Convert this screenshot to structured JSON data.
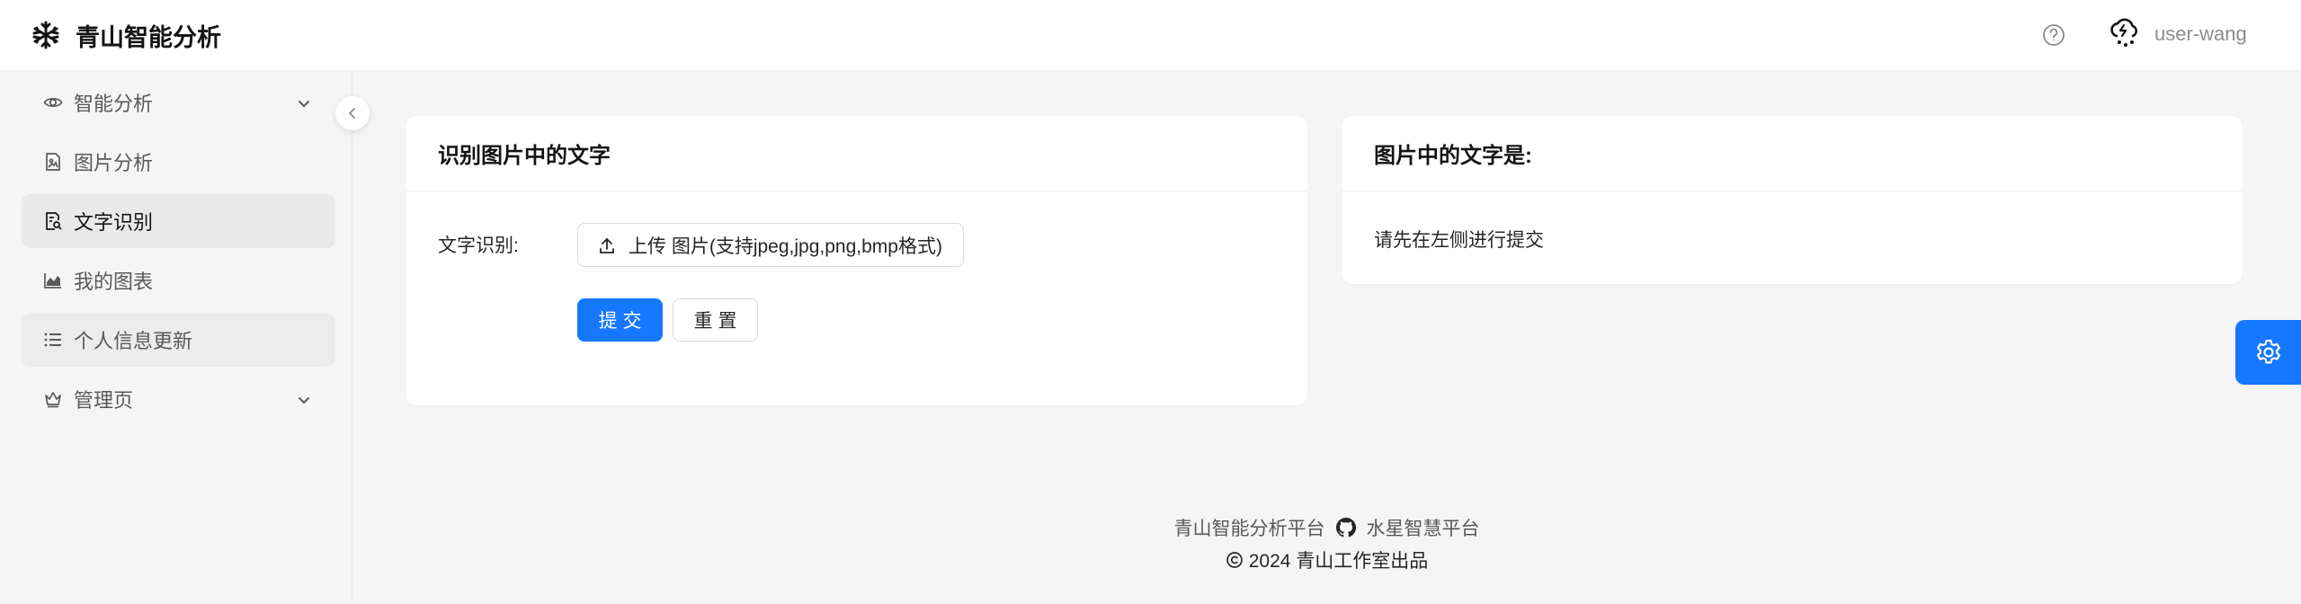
{
  "header": {
    "app_title": "青山智能分析",
    "user_name": "user-wang",
    "logo_icon": "snowflake-logo-icon",
    "help_icon": "question-circle-icon",
    "avatar_icon": "cloud-rain-avatar-icon"
  },
  "sidebar": {
    "items": [
      {
        "label": "智能分析",
        "icon": "eye-icon",
        "has_submenu": true
      },
      {
        "label": "图片分析",
        "icon": "image-file-icon"
      },
      {
        "label": "文字识别",
        "icon": "file-search-icon",
        "active": true
      },
      {
        "label": "我的图表",
        "icon": "area-chart-icon"
      },
      {
        "label": "个人信息更新",
        "icon": "list-icon"
      },
      {
        "label": "管理页",
        "icon": "crown-icon",
        "has_submenu": true
      }
    ]
  },
  "left_card": {
    "title": "识别图片中的文字",
    "form_label": "文字识别:",
    "upload_label": "上传 图片(支持jpeg,jpg,png,bmp格式)",
    "submit_label": "提交",
    "reset_label": "重置"
  },
  "right_card": {
    "title": "图片中的文字是:",
    "placeholder_text": "请先在左侧进行提交"
  },
  "footer": {
    "platform_left": "青山智能分析平台",
    "platform_right": "水星智慧平台",
    "copyright": "2024 青山工作室出品"
  },
  "colors": {
    "primary": "#1677ff",
    "background": "#f5f5f5",
    "active_menu_bg": "#e9e9e9"
  }
}
